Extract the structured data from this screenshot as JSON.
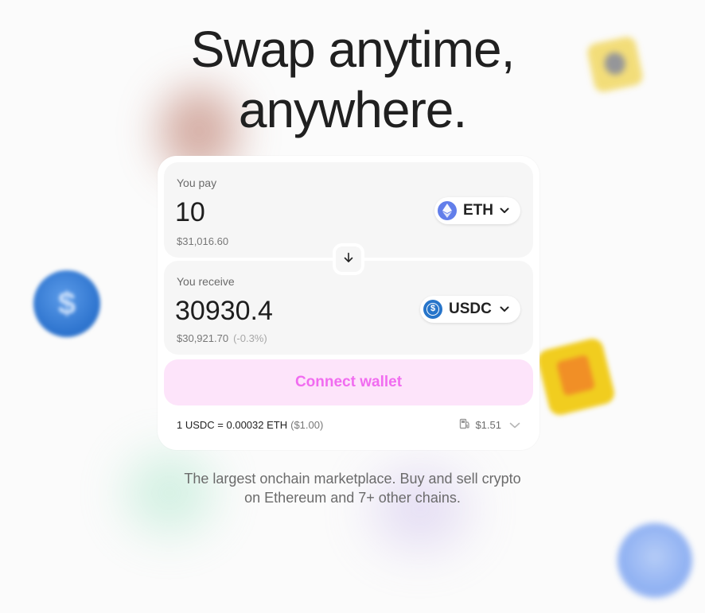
{
  "headline": {
    "line1": "Swap anytime,",
    "line2": "anywhere."
  },
  "swap": {
    "pay": {
      "label": "You pay",
      "amount": "10",
      "usd_value": "$31,016.60",
      "token": {
        "symbol": "ETH",
        "icon": "ethereum-icon",
        "color": "#627eea"
      }
    },
    "receive": {
      "label": "You receive",
      "amount": "30930.4",
      "usd_value": "$30,921.70",
      "price_impact": "(-0.3%)",
      "token": {
        "symbol": "USDC",
        "icon": "usdc-icon",
        "color": "#2775ca"
      }
    },
    "connect_button_label": "Connect wallet",
    "rate": {
      "text": "1 USDC = 0.00032 ETH",
      "usd": "($1.00)"
    },
    "gas": {
      "icon": "gas-pump-icon",
      "value": "$1.51"
    }
  },
  "tagline": {
    "line1": "The largest onchain marketplace. Buy and sell crypto",
    "line2": "on Ethereum and 7+ other chains."
  },
  "colors": {
    "accent_pink": "#f16cf0",
    "accent_pink_bg": "#fde4fa",
    "panel_bg": "#f6f6f6"
  }
}
